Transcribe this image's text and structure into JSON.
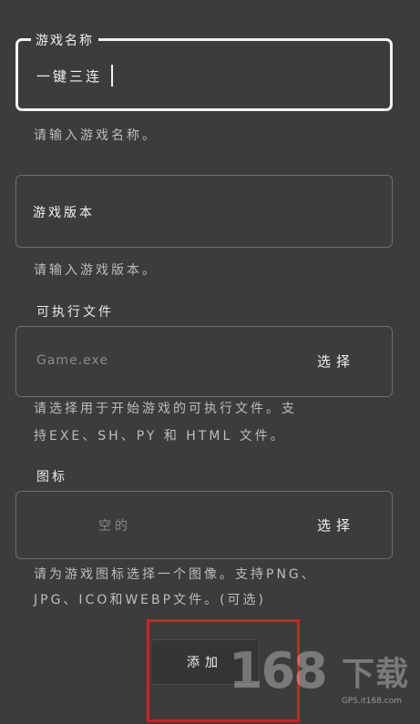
{
  "form": {
    "game_name": {
      "label": "游戏名称",
      "value": "一键三连",
      "hint": "请输入游戏名称。"
    },
    "game_version": {
      "placeholder": "游戏版本",
      "hint": "请输入游戏版本。"
    },
    "executable": {
      "section_label": "可执行文件",
      "placeholder": "Game.exe",
      "button_label": "选择",
      "hint_line1": "请选择用于开始游戏的可执行文件。支",
      "hint_line2": "持EXE、SH、PY 和 HTML 文件。"
    },
    "icon": {
      "section_label": "图标",
      "placeholder": "空的",
      "button_label": "选择",
      "hint_line1": "请为游戏图标选择一个图像。支持PNG、",
      "hint_line2": "JPG、ICO和WEBP文件。(可选)"
    },
    "add_button_label": "添加"
  },
  "watermark": {
    "digits": "168",
    "text": "下载",
    "url": "GPS.it168.com"
  },
  "colors": {
    "background": "#3c3c3c",
    "highlight": "#d42020",
    "text": "#e8e8e8",
    "hint": "#bdbdbd"
  }
}
